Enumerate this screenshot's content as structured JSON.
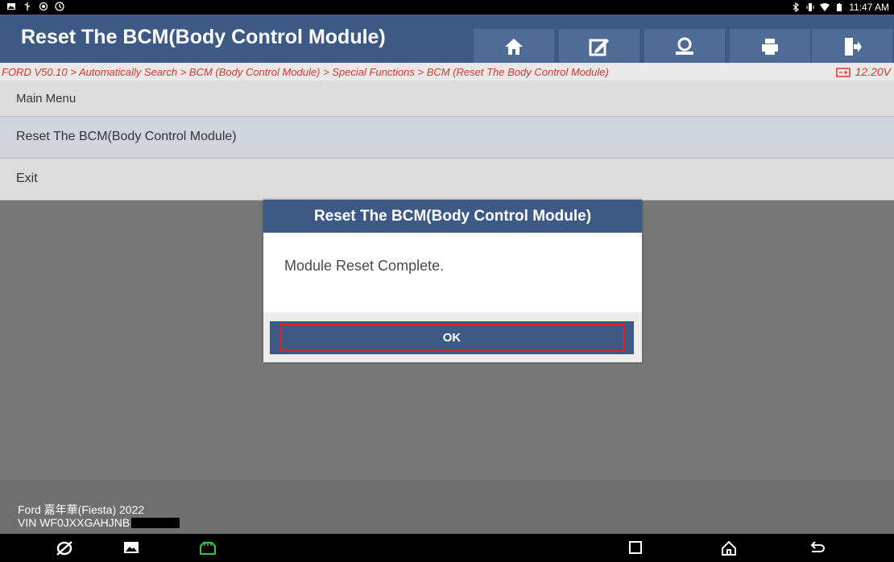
{
  "status_bar": {
    "time": "11:47 AM",
    "left_icons": [
      "image-icon",
      "usb-icon",
      "record-icon",
      "alarm-icon"
    ],
    "right_icons": [
      "bluetooth-icon",
      "vibrate-icon",
      "wifi-icon",
      "battery-icon"
    ]
  },
  "header": {
    "title": "Reset The BCM(Body Control Module)",
    "buttons": [
      "home-icon",
      "edit-icon",
      "user-icon",
      "print-icon",
      "exit-icon"
    ]
  },
  "breadcrumb": {
    "path": "FORD V50.10 > Automatically Search > BCM (Body Control Module) > Special Functions > BCM (Reset The Body Control Module)",
    "voltage": "12.20V"
  },
  "list": {
    "header": "Main Menu",
    "items": [
      "Reset The BCM(Body Control Module)",
      "Exit"
    ]
  },
  "dialog": {
    "title": "Reset The BCM(Body Control Module)",
    "message": "Module Reset Complete.",
    "ok_label": "OK"
  },
  "footer": {
    "vehicle": "Ford 嘉年華(Fiesta) 2022",
    "vin": "VIN WF0JXXGAHJNB"
  },
  "navbar": {
    "icons": [
      "browser-icon",
      "gallery-icon",
      "vci-icon",
      "recents-icon",
      "home-nav-icon",
      "back-icon"
    ]
  },
  "colors": {
    "header_bg": "#3d5a86",
    "breadcrumb_text": "#d23a2a",
    "highlight": "#e02020",
    "vci_green": "#3cc24a"
  }
}
